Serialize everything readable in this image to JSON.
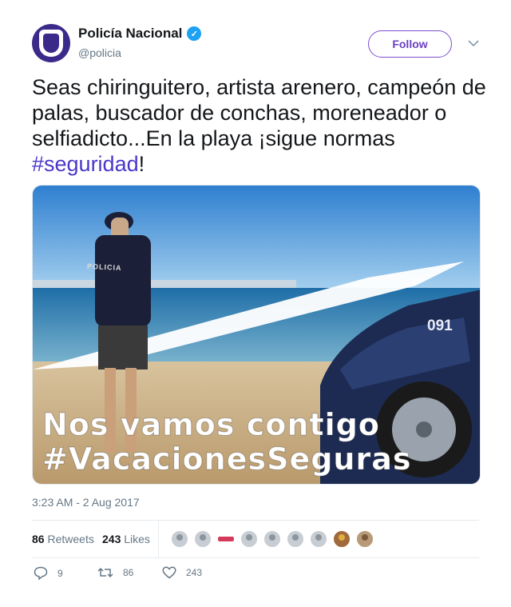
{
  "account": {
    "display_name": "Policía Nacional",
    "handle": "@policia",
    "verified_icon": "verified-badge-icon",
    "avatar_icon": "police-badge-avatar"
  },
  "follow_button": {
    "label": "Follow"
  },
  "tweet": {
    "text_before": "Seas chiringuitero, artista arenero, campeón de palas, buscador de conchas, moreneador o selfiadicto...En la playa ¡sigue normas ",
    "hashtag": "#seguridad",
    "text_after": "!",
    "timestamp": "3:23 AM - 2 Aug 2017"
  },
  "media": {
    "overlay_line1": "Nos vamos contigo",
    "overlay_line2": "#VacacionesSeguras",
    "vehicle_plate": "091",
    "uniform_label": "POLICIA"
  },
  "stats": {
    "retweets_count": "86",
    "retweets_label": "Retweets",
    "likes_count": "243",
    "likes_label": "Likes"
  },
  "actions": {
    "reply_count": "9",
    "retweet_count": "86",
    "like_count": "243"
  },
  "colors": {
    "accent": "#1da1f2",
    "follow": "#6a3fc0",
    "hashtag": "#4a37c8",
    "muted": "#657786"
  }
}
